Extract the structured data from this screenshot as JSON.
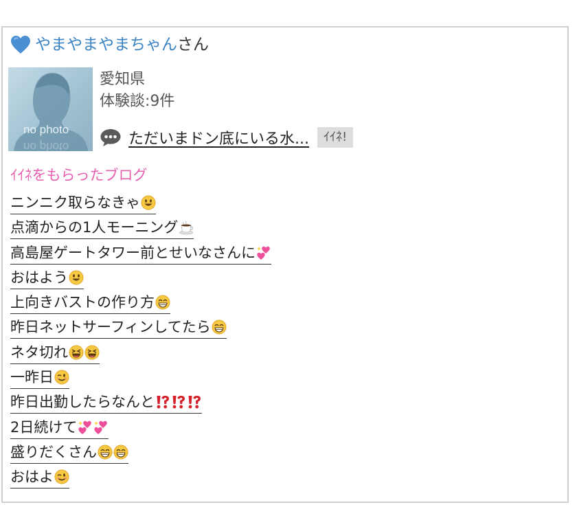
{
  "user": {
    "name": "やまやまやまちゃん",
    "suffix": "さん",
    "heart_icon": "blue-heart-icon",
    "heart_color": "#4a8fd4"
  },
  "profile": {
    "avatar_text": "no photo",
    "prefecture": "愛知県",
    "experience_count": "体験談:9件",
    "latest_post_title": "ただいまドン底にいる水...",
    "iine_label": "ｲｲﾈ!",
    "comment_icon": "speech-bubble-icon"
  },
  "liked_blogs": {
    "heading": "ｲｲﾈをもらったブログ",
    "heading_color": "#e85fae",
    "items": [
      {
        "text": "ニンニク取らなきゃ",
        "emojis": [
          "smile"
        ]
      },
      {
        "text": "点滴からの1人モーニング",
        "emojis": [
          "coffee"
        ]
      },
      {
        "text": "高島屋ゲートタワー前とせいなさんに",
        "emojis": [
          "two-hearts"
        ]
      },
      {
        "text": "おはよう",
        "emojis": [
          "smile"
        ]
      },
      {
        "text": "上向きバストの作り方",
        "emojis": [
          "grin"
        ]
      },
      {
        "text": "昨日ネットサーフィンしてたら",
        "emojis": [
          "grin"
        ]
      },
      {
        "text": "ネタ切れ",
        "emojis": [
          "laugh",
          "laugh"
        ]
      },
      {
        "text": "一昨日",
        "emojis": [
          "wink"
        ]
      },
      {
        "text": "昨日出勤したらなんと",
        "emojis": [
          "interrobang",
          "interrobang",
          "interrobang"
        ]
      },
      {
        "text": "2日続けて",
        "emojis": [
          "two-hearts",
          "two-hearts"
        ]
      },
      {
        "text": "盛りだくさん",
        "emojis": [
          "grin",
          "grin"
        ]
      },
      {
        "text": "おはよ",
        "emojis": [
          "wink"
        ]
      }
    ]
  }
}
